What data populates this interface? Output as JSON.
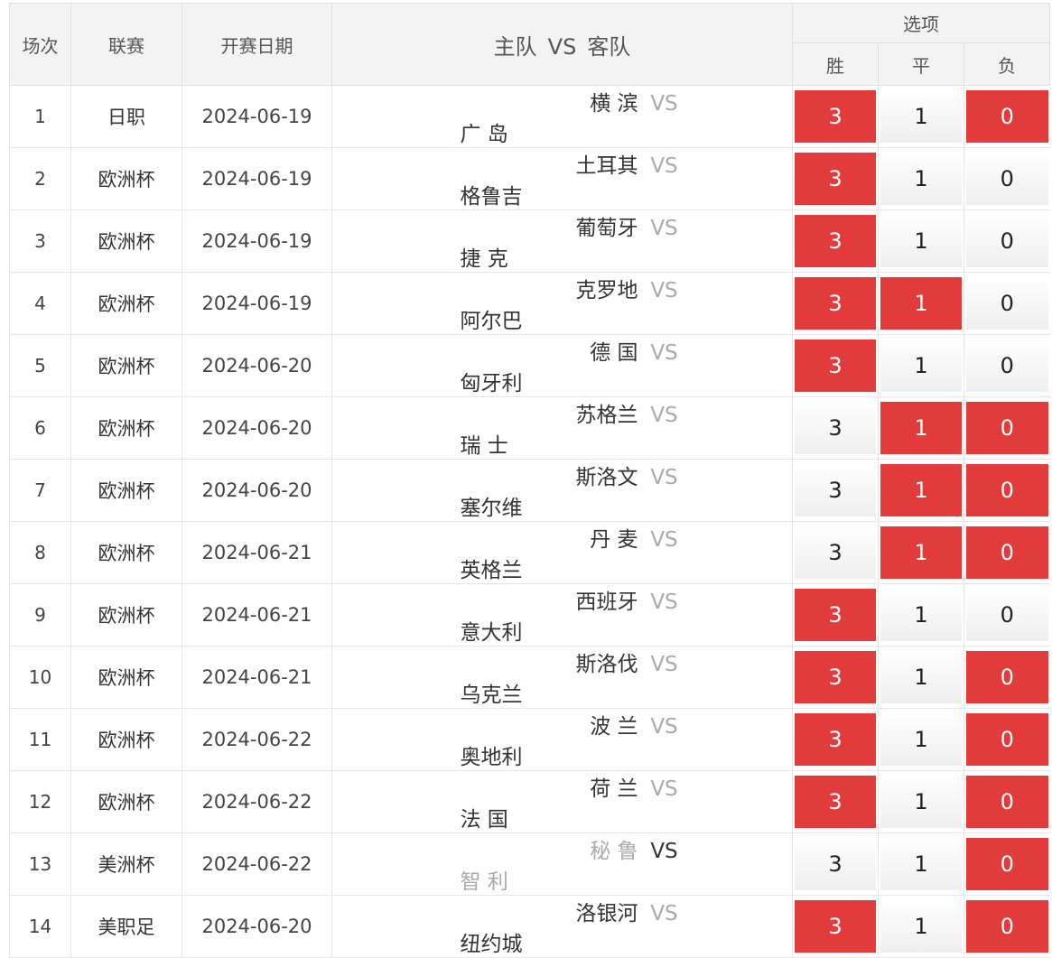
{
  "header": {
    "col_index": "场次",
    "col_league": "联赛",
    "col_date": "开赛日期",
    "col_home": "主队",
    "col_vs": "VS",
    "col_away": "客队",
    "col_options": "选项",
    "opt_win": "胜",
    "opt_draw": "平",
    "opt_lose": "负"
  },
  "colors": {
    "selected": "#e23b3b",
    "header_bg": "#f3f3f3"
  },
  "rows": [
    {
      "index": "1",
      "league": "日职",
      "date": "2024-06-19",
      "home": "横 滨",
      "vs": "VS",
      "away": "广 岛",
      "win": "3",
      "draw": "1",
      "lose": "0",
      "sel": [
        true,
        false,
        true
      ],
      "muted": false
    },
    {
      "index": "2",
      "league": "欧洲杯",
      "date": "2024-06-19",
      "home": "土耳其",
      "vs": "VS",
      "away": "格鲁吉",
      "win": "3",
      "draw": "1",
      "lose": "0",
      "sel": [
        true,
        false,
        false
      ],
      "muted": false
    },
    {
      "index": "3",
      "league": "欧洲杯",
      "date": "2024-06-19",
      "home": "葡萄牙",
      "vs": "VS",
      "away": "捷 克",
      "win": "3",
      "draw": "1",
      "lose": "0",
      "sel": [
        true,
        false,
        false
      ],
      "muted": false
    },
    {
      "index": "4",
      "league": "欧洲杯",
      "date": "2024-06-19",
      "home": "克罗地",
      "vs": "VS",
      "away": "阿尔巴",
      "win": "3",
      "draw": "1",
      "lose": "0",
      "sel": [
        true,
        true,
        false
      ],
      "muted": false
    },
    {
      "index": "5",
      "league": "欧洲杯",
      "date": "2024-06-20",
      "home": "德 国",
      "vs": "VS",
      "away": "匈牙利",
      "win": "3",
      "draw": "1",
      "lose": "0",
      "sel": [
        true,
        false,
        false
      ],
      "muted": false
    },
    {
      "index": "6",
      "league": "欧洲杯",
      "date": "2024-06-20",
      "home": "苏格兰",
      "vs": "VS",
      "away": "瑞 士",
      "win": "3",
      "draw": "1",
      "lose": "0",
      "sel": [
        false,
        true,
        true
      ],
      "muted": false
    },
    {
      "index": "7",
      "league": "欧洲杯",
      "date": "2024-06-20",
      "home": "斯洛文",
      "vs": "VS",
      "away": "塞尔维",
      "win": "3",
      "draw": "1",
      "lose": "0",
      "sel": [
        false,
        true,
        true
      ],
      "muted": false
    },
    {
      "index": "8",
      "league": "欧洲杯",
      "date": "2024-06-21",
      "home": "丹 麦",
      "vs": "VS",
      "away": "英格兰",
      "win": "3",
      "draw": "1",
      "lose": "0",
      "sel": [
        false,
        true,
        true
      ],
      "muted": false
    },
    {
      "index": "9",
      "league": "欧洲杯",
      "date": "2024-06-21",
      "home": "西班牙",
      "vs": "VS",
      "away": "意大利",
      "win": "3",
      "draw": "1",
      "lose": "0",
      "sel": [
        true,
        false,
        false
      ],
      "muted": false
    },
    {
      "index": "10",
      "league": "欧洲杯",
      "date": "2024-06-21",
      "home": "斯洛伐",
      "vs": "VS",
      "away": "乌克兰",
      "win": "3",
      "draw": "1",
      "lose": "0",
      "sel": [
        true,
        false,
        true
      ],
      "muted": false
    },
    {
      "index": "11",
      "league": "欧洲杯",
      "date": "2024-06-22",
      "home": "波 兰",
      "vs": "VS",
      "away": "奥地利",
      "win": "3",
      "draw": "1",
      "lose": "0",
      "sel": [
        true,
        false,
        true
      ],
      "muted": false
    },
    {
      "index": "12",
      "league": "欧洲杯",
      "date": "2024-06-22",
      "home": "荷 兰",
      "vs": "VS",
      "away": "法 国",
      "win": "3",
      "draw": "1",
      "lose": "0",
      "sel": [
        true,
        false,
        true
      ],
      "muted": false
    },
    {
      "index": "13",
      "league": "美洲杯",
      "date": "2024-06-22",
      "home": "秘 鲁",
      "vs": "VS",
      "away": "智 利",
      "win": "3",
      "draw": "1",
      "lose": "0",
      "sel": [
        false,
        false,
        true
      ],
      "muted": true
    },
    {
      "index": "14",
      "league": "美职足",
      "date": "2024-06-20",
      "home": "洛银河",
      "vs": "VS",
      "away": "纽约城",
      "win": "3",
      "draw": "1",
      "lose": "0",
      "sel": [
        true,
        false,
        true
      ],
      "muted": false
    }
  ]
}
